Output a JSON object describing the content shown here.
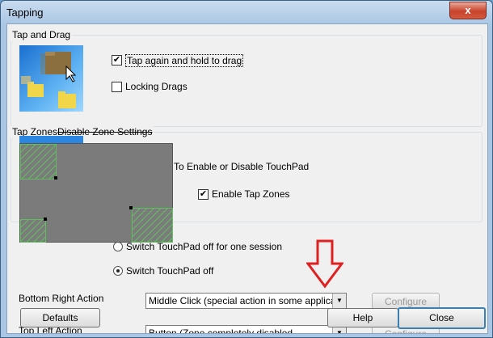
{
  "window": {
    "title": "Tapping",
    "close_glyph": "x"
  },
  "tap_and_drag": {
    "group_label": "Tap and Drag",
    "tap_again_label": "Tap again and hold to drag",
    "tap_again_checked": true,
    "locking_drags_label": "Locking Drags",
    "locking_drags_checked": false
  },
  "tap_zones": {
    "group_label": "Tap Zones",
    "overlay_label": "Disable Zone Settings",
    "enable_disable_label": "To Enable or Disable TouchPad",
    "enable_tap_zones_label": "Enable Tap Zones",
    "enable_tap_zones_checked": true,
    "switch_off_session_label": "Switch TouchPad off for one session",
    "switch_off_label": "Switch TouchPad off",
    "selected_option": "Switch TouchPad off"
  },
  "actions": {
    "bottom_right_label": "Bottom Right Action",
    "bottom_right_value": "Middle Click (special action in some applications)",
    "top_left_label": "Top Left Action",
    "top_left_value": "Button (Zone completely disabled",
    "configure_label": "Configure"
  },
  "buttons": {
    "defaults": "Defaults",
    "help": "Help",
    "close": "Close"
  },
  "colors": {
    "arrow_red": "#e02020",
    "zone_gray": "#7b7b7b",
    "zone_hatch": "#5fbf5f",
    "close_button_red": "#c7432b"
  },
  "icons": {
    "tap_drag_illustration": "folder-drag-icon",
    "annotation": "down-arrow-icon"
  }
}
